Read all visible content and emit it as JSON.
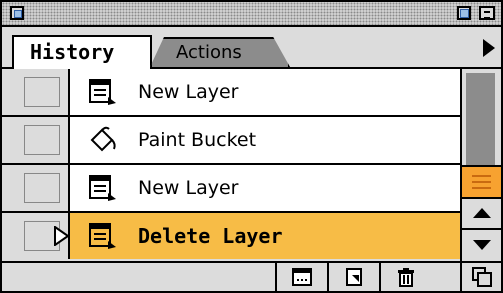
{
  "window": {
    "controls": [
      "close-box",
      "zoom-box",
      "collapse-box"
    ]
  },
  "tabs": [
    {
      "label": "History",
      "active": true
    },
    {
      "label": "Actions",
      "active": false
    }
  ],
  "history": {
    "items": [
      {
        "label": "New Layer",
        "icon": "new-layer-icon",
        "selected": false
      },
      {
        "label": "Paint Bucket",
        "icon": "paint-bucket-icon",
        "selected": false
      },
      {
        "label": "New Layer",
        "icon": "new-layer-icon",
        "selected": false
      },
      {
        "label": "Delete Layer",
        "icon": "delete-layer-icon",
        "selected": true
      }
    ],
    "selected_color": "#f7bc46"
  },
  "scrollbar": {
    "thumb_color": "#f7a230"
  },
  "footer": {
    "buttons": [
      "new-document-icon",
      "new-snapshot-icon",
      "trash-icon"
    ],
    "resize": "resize-icon"
  }
}
